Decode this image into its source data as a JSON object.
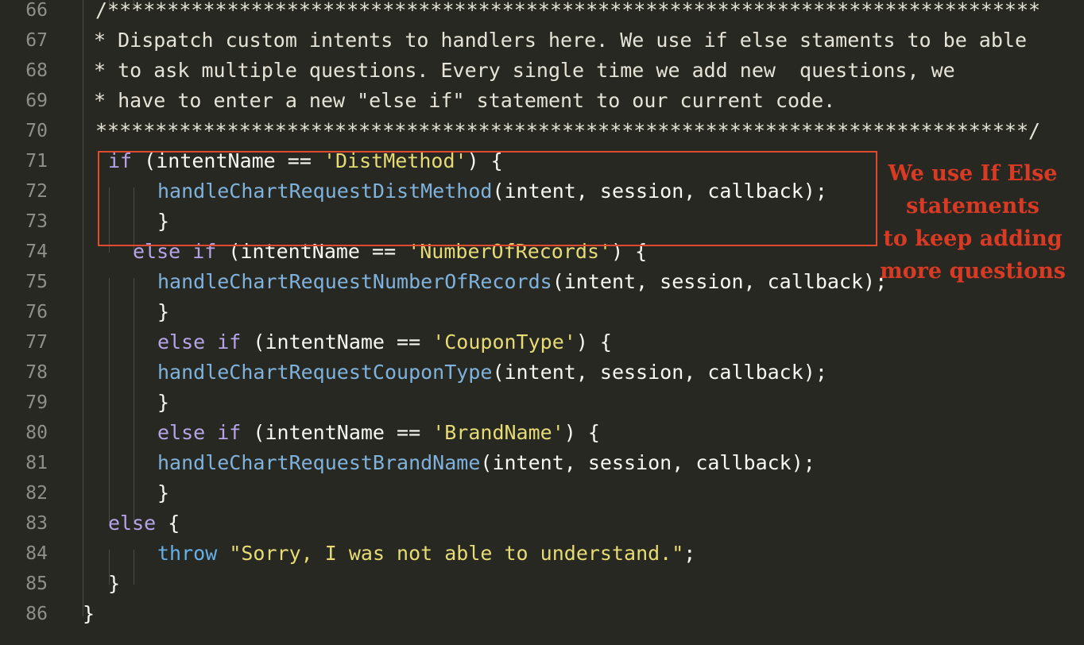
{
  "editor": {
    "lines": [
      {
        "num": "66",
        "indent": 120,
        "tokens": [
          {
            "t": "/******************************************************************************",
            "c": "comment"
          }
        ]
      },
      {
        "num": "67",
        "indent": 118,
        "tokens": [
          {
            "t": "* Dispatch custom intents to handlers here. We use if else staments to be able",
            "c": "comment"
          }
        ]
      },
      {
        "num": "68",
        "indent": 118,
        "tokens": [
          {
            "t": "* to ask multiple questions. Every single time we add new  questions, we",
            "c": "comment"
          }
        ]
      },
      {
        "num": "69",
        "indent": 118,
        "tokens": [
          {
            "t": "* have to enter a new \"else if\" statement to our current code.",
            "c": "comment"
          }
        ]
      },
      {
        "num": "70",
        "indent": 120,
        "tokens": [
          {
            "t": "******************************************************************************/",
            "c": "comment"
          }
        ]
      },
      {
        "num": "71",
        "indent": 136,
        "tokens": [
          {
            "t": "if",
            "c": "kw"
          },
          {
            "t": " (intentName == ",
            "c": "plain"
          },
          {
            "t": "'DistMethod'",
            "c": "str"
          },
          {
            "t": ") {",
            "c": "plain"
          }
        ]
      },
      {
        "num": "72",
        "indent": 198,
        "tokens": [
          {
            "t": "handleChartRequestDistMethod",
            "c": "fn"
          },
          {
            "t": "(intent, session, callback);",
            "c": "plain"
          }
        ]
      },
      {
        "num": "73",
        "indent": 198,
        "tokens": [
          {
            "t": "}",
            "c": "plain"
          }
        ]
      },
      {
        "num": "74",
        "indent": 167,
        "tokens": [
          {
            "t": "else if",
            "c": "kw"
          },
          {
            "t": " (intentName == ",
            "c": "plain"
          },
          {
            "t": "'NumberOfRecords'",
            "c": "str"
          },
          {
            "t": ") {",
            "c": "plain"
          }
        ]
      },
      {
        "num": "75",
        "indent": 198,
        "tokens": [
          {
            "t": "handleChartRequestNumberOfRecords",
            "c": "fn"
          },
          {
            "t": "(intent, session, callback);",
            "c": "plain"
          }
        ]
      },
      {
        "num": "76",
        "indent": 198,
        "tokens": [
          {
            "t": "}",
            "c": "plain"
          }
        ]
      },
      {
        "num": "77",
        "indent": 198,
        "tokens": [
          {
            "t": "else if",
            "c": "kw"
          },
          {
            "t": " (intentName == ",
            "c": "plain"
          },
          {
            "t": "'CouponType'",
            "c": "str"
          },
          {
            "t": ") {",
            "c": "plain"
          }
        ]
      },
      {
        "num": "78",
        "indent": 198,
        "tokens": [
          {
            "t": "handleChartRequestCouponType",
            "c": "fn"
          },
          {
            "t": "(intent, session, callback);",
            "c": "plain"
          }
        ]
      },
      {
        "num": "79",
        "indent": 198,
        "tokens": [
          {
            "t": "}",
            "c": "plain"
          }
        ]
      },
      {
        "num": "80",
        "indent": 198,
        "tokens": [
          {
            "t": "else if",
            "c": "kw"
          },
          {
            "t": " (intentName == ",
            "c": "plain"
          },
          {
            "t": "'BrandName'",
            "c": "str"
          },
          {
            "t": ") {",
            "c": "plain"
          }
        ]
      },
      {
        "num": "81",
        "indent": 198,
        "tokens": [
          {
            "t": "handleChartRequestBrandName",
            "c": "fn"
          },
          {
            "t": "(intent, session, callback);",
            "c": "plain"
          }
        ]
      },
      {
        "num": "82",
        "indent": 198,
        "tokens": [
          {
            "t": "}",
            "c": "plain"
          }
        ]
      },
      {
        "num": "83",
        "indent": 136,
        "tokens": [
          {
            "t": "else",
            "c": "kw"
          },
          {
            "t": " {",
            "c": "plain"
          }
        ]
      },
      {
        "num": "84",
        "indent": 198,
        "tokens": [
          {
            "t": "throw",
            "c": "throw"
          },
          {
            "t": " ",
            "c": "plain"
          },
          {
            "t": "\"Sorry, I was not able to understand.\"",
            "c": "str"
          },
          {
            "t": ";",
            "c": "plain"
          }
        ]
      },
      {
        "num": "85",
        "indent": 136,
        "tokens": [
          {
            "t": "}",
            "c": "plain"
          }
        ]
      },
      {
        "num": "86",
        "indent": 104,
        "tokens": [
          {
            "t": "}",
            "c": "plain"
          }
        ]
      }
    ]
  },
  "annotation": {
    "lines": [
      "We use If Else",
      "statements",
      "to keep adding",
      "more questions"
    ],
    "color": "#d93a24"
  },
  "colors": {
    "background": "#272822",
    "keyword": "#b6a4e8",
    "function": "#7fb2dd",
    "string": "#e6db74",
    "comment": "#e6e4d9",
    "highlight_box": "#e04a2e"
  }
}
